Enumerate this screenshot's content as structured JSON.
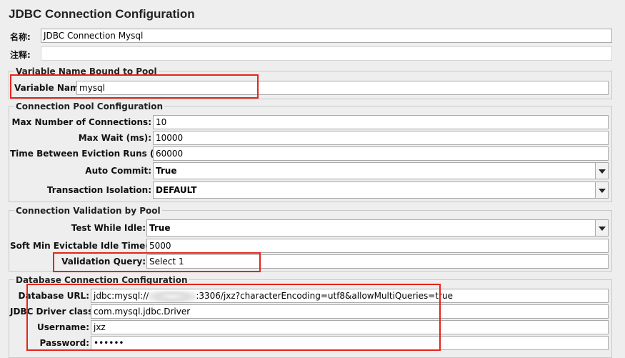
{
  "title": "JDBC Connection Configuration",
  "name": {
    "label": "名称:",
    "value": "JDBC Connection Mysql"
  },
  "comment": {
    "label": "注释:",
    "value": ""
  },
  "variable_group": {
    "legend": "Variable Name Bound to Pool",
    "label": "Variable Name:",
    "value": "mysql"
  },
  "pool_group": {
    "legend": "Connection Pool Configuration",
    "max_connections": {
      "label": "Max Number of Connections:",
      "value": "10"
    },
    "max_wait": {
      "label": "Max Wait (ms):",
      "value": "10000"
    },
    "eviction": {
      "label": "Time Between Eviction Runs (ms):",
      "value": "60000"
    },
    "auto_commit": {
      "label": "Auto Commit:",
      "value": "True"
    },
    "isolation": {
      "label": "Transaction Isolation:",
      "value": "DEFAULT"
    }
  },
  "validation_group": {
    "legend": "Connection Validation by Pool",
    "test_idle": {
      "label": "Test While Idle:",
      "value": "True"
    },
    "soft_min": {
      "label": "Soft Min Evictable Idle Time(ms):",
      "value": "5000"
    },
    "query": {
      "label": "Validation Query:",
      "value": "Select 1"
    }
  },
  "db_group": {
    "legend": "Database Connection Configuration",
    "url": {
      "label": "Database URL:",
      "value_prefix": "jdbc:mysql://",
      "value_suffix": ":3306/jxz?characterEncoding=utf8&allowMultiQueries=true"
    },
    "driver": {
      "label": "JDBC Driver class:",
      "value": "com.mysql.jdbc.Driver"
    },
    "username": {
      "label": "Username:",
      "value": "jxz"
    },
    "password": {
      "label": "Password:",
      "value": "••••••"
    }
  },
  "colors": {
    "highlight": "#e8231a",
    "background": "#eeeeee",
    "field_border": "#a9a9a9"
  },
  "icons": {
    "dropdown": "chevron-down-icon"
  }
}
